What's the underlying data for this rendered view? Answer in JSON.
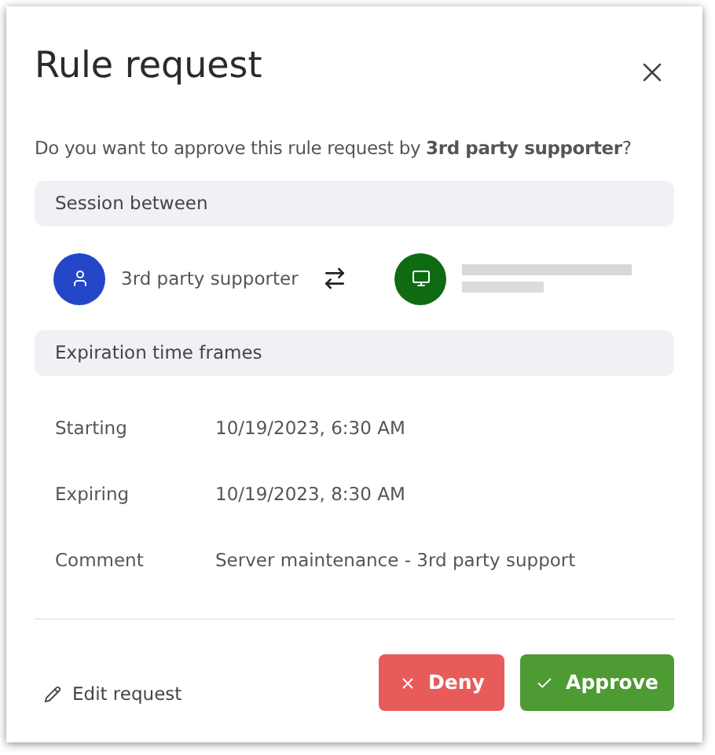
{
  "dialog": {
    "title": "Rule request",
    "question": "Do you want to approve this rule request by **3rd party supporter**?"
  },
  "session": {
    "header": "Session between",
    "from": "3rd party supporter"
  },
  "expiration": {
    "header": "Expiration time frames",
    "rows": [
      {
        "label": "Starting",
        "value": "10/19/2023, 6:30 AM"
      },
      {
        "label": "Expiring",
        "value": "10/19/2023, 8:30 AM"
      },
      {
        "label": "Comment",
        "value": "Server maintenance - 3rd party support"
      }
    ]
  },
  "footer": {
    "edit": "Edit request",
    "deny": "Deny",
    "approve": "Approve"
  }
}
